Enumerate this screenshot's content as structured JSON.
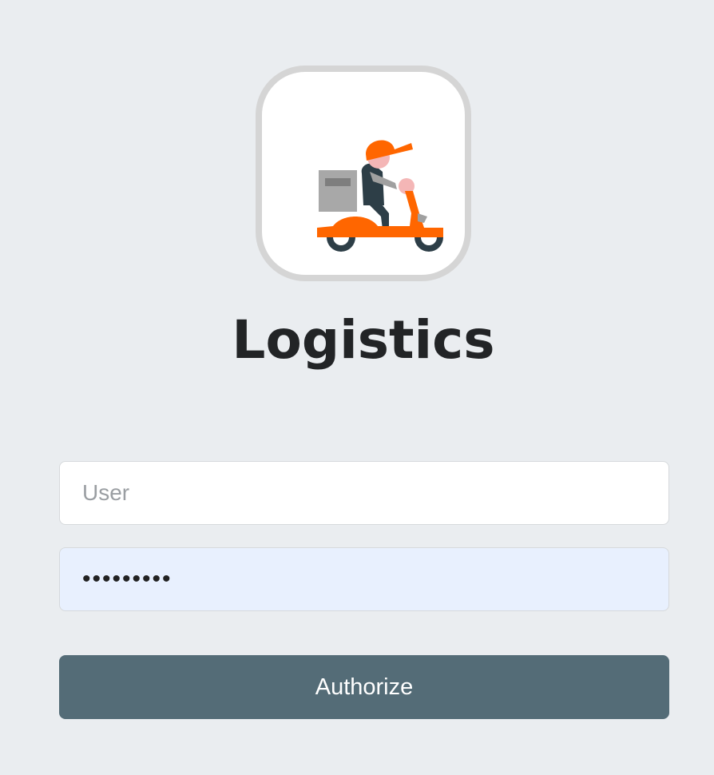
{
  "app": {
    "logo_icon": "delivery-scooter-icon",
    "title": "Logistics"
  },
  "login": {
    "user_placeholder": "User",
    "user_value": "",
    "password_value": "qwertyuio",
    "password_placeholder": "",
    "authorize_label": "Authorize"
  },
  "colors": {
    "background": "#eaedf0",
    "button": "#546c77",
    "button_text": "#ffffff",
    "autofill_bg": "#e8f0fe",
    "logo_orange": "#ff6600",
    "logo_dark": "#2d3e47"
  }
}
